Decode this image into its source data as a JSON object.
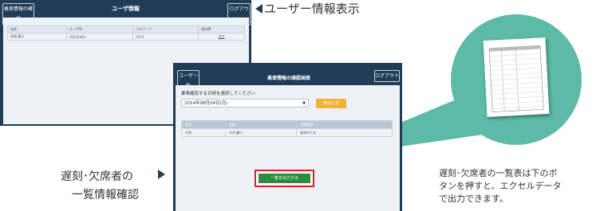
{
  "screen_user": {
    "header_button": "乗車情報の確認",
    "title": "ユーザ情報",
    "logout": "ログアウト",
    "columns": [
      "名前",
      "ユーザID",
      "パスワード",
      "操作欄"
    ],
    "row": [
      "西岡 慶己",
      "10252024",
      "3574",
      "出力"
    ]
  },
  "screen_absence": {
    "header_button": "ユーザ一覧",
    "title": "乗車情報の確認画面",
    "logout": "ログアウト",
    "prompt": "乗車確認する日時を選択してください",
    "date_value": "2014年08月04日(月)",
    "show_button": "表示する",
    "columns": [
      "状況",
      "名前",
      "欠席理由"
    ],
    "row": [
      "欠席",
      "木本 麗人",
      "風邪のため"
    ],
    "output_button": "一覧を出力する"
  },
  "callouts": {
    "user_info": "ユーザー情報表示",
    "absence_line1": "遅刻･欠席者の",
    "absence_line2": "一覧情報確認",
    "note_line1": "遅刻･欠席者の一覧表は下のボ",
    "note_line2": "タンを押すと、エクセルデータ",
    "note_line3": "で出力できます。"
  },
  "colors": {
    "navy": "#1f3d56",
    "teal": "#5bbba6",
    "red_frame": "#e01f26",
    "green_button": "#2e8b3d",
    "yellow_button": "#f2b233"
  }
}
